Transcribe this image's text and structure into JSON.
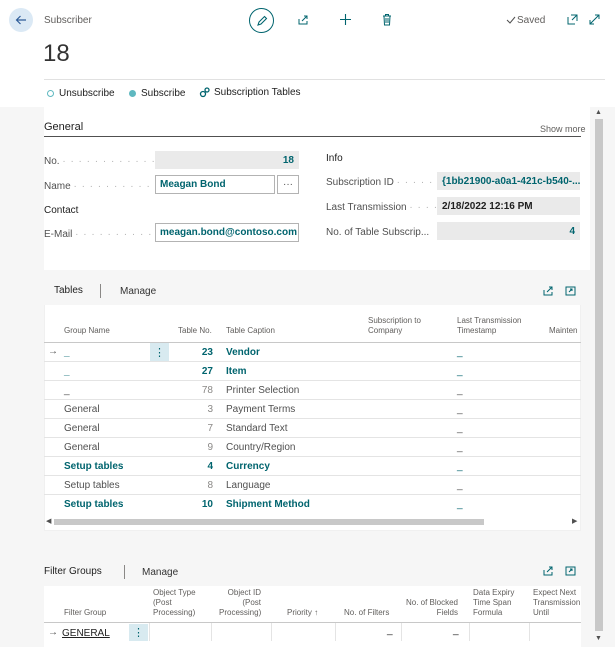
{
  "header": {
    "page_type": "Subscriber",
    "record_title": "18",
    "saved_label": "Saved"
  },
  "actions": {
    "unsubscribe": "Unsubscribe",
    "subscribe": "Subscribe",
    "subscription_tables": "Subscription Tables"
  },
  "general": {
    "title": "General",
    "show_more": "Show more",
    "no_label": "No.",
    "no_value": "18",
    "name_label": "Name",
    "name_value": "Meagan Bond",
    "contact_heading": "Contact",
    "email_label": "E-Mail",
    "email_value": "meagan.bond@contoso.com",
    "info_heading": "Info",
    "subscription_id_label": "Subscription ID",
    "subscription_id_value": "{1bb21900-a0a1-421c-b540-...",
    "last_transmission_label": "Last Transmission",
    "last_transmission_value": "2/18/2022 12:16 PM",
    "table_subs_label": "No. of Table Subscrip...",
    "table_subs_value": "4"
  },
  "tables": {
    "tab_title": "Tables",
    "manage": "Manage",
    "columns": {
      "group_name": "Group Name",
      "table_no": "Table No.",
      "table_caption": "Table Caption",
      "sub_company_1": "Subscription to",
      "sub_company_2": "Company",
      "last_trans_1": "Last Transmission",
      "last_trans_2": "Timestamp",
      "maint": "Mainten"
    },
    "rows": [
      {
        "group": "_",
        "no": "23",
        "caption": "Vendor",
        "sub": "",
        "ts": "_",
        "bold": true,
        "teal": true
      },
      {
        "group": "_",
        "no": "27",
        "caption": "Item",
        "sub": "",
        "ts": "_",
        "bold": true,
        "teal": true
      },
      {
        "group": "_",
        "no": "78",
        "caption": "Printer Selection",
        "sub": "",
        "ts": "_",
        "bold": false,
        "teal": false
      },
      {
        "group": "General",
        "no": "3",
        "caption": "Payment Terms",
        "sub": "",
        "ts": "_",
        "bold": false,
        "teal": false
      },
      {
        "group": "General",
        "no": "7",
        "caption": "Standard Text",
        "sub": "",
        "ts": "_",
        "bold": false,
        "teal": false
      },
      {
        "group": "General",
        "no": "9",
        "caption": "Country/Region",
        "sub": "",
        "ts": "_",
        "bold": false,
        "teal": false
      },
      {
        "group": "Setup tables",
        "no": "4",
        "caption": "Currency",
        "sub": "",
        "ts": "_",
        "bold": true,
        "teal": true
      },
      {
        "group": "Setup tables",
        "no": "8",
        "caption": "Language",
        "sub": "",
        "ts": "_",
        "bold": false,
        "teal": false
      },
      {
        "group": "Setup tables",
        "no": "10",
        "caption": "Shipment Method",
        "sub": "",
        "ts": "_",
        "bold": true,
        "teal": true
      }
    ]
  },
  "filter_groups": {
    "tab_title": "Filter Groups",
    "manage": "Manage",
    "columns": {
      "filter_group": "Filter Group",
      "obj_type_1": "Object Type",
      "obj_type_2": "(Post",
      "obj_type_3": "Processing)",
      "obj_id_1": "Object ID",
      "obj_id_2": "(Post",
      "obj_id_3": "Processing)",
      "priority": "Priority ↑",
      "no_filters": "No. of Filters",
      "blocked_1": "No. of Blocked",
      "blocked_2": "Fields",
      "expiry_1": "Data Expiry",
      "expiry_2": "Time Span",
      "expiry_3": "Formula",
      "expect_1": "Expect Next",
      "expect_2": "Transmission",
      "expect_3": "Until"
    },
    "rows": [
      {
        "group": "GENERAL",
        "no_filters": "_",
        "blocked": "_"
      }
    ]
  },
  "colors": {
    "accent": "#00646e",
    "teal_dot": "#5fb8c0",
    "back_button_bg": "#dbe9f5"
  }
}
